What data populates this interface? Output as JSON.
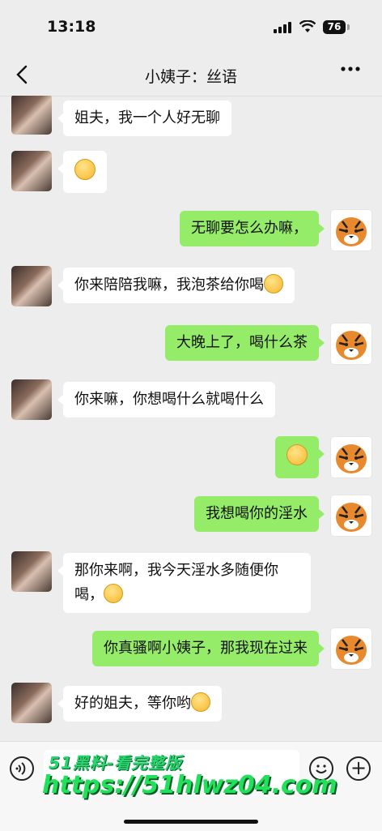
{
  "status_bar": {
    "time": "13:18",
    "battery": "76"
  },
  "nav": {
    "back_icon": "chevron-left-icon",
    "title": "小姨子：丝语",
    "more_icon": "more-dots-icon"
  },
  "messages": [
    {
      "side": "in",
      "text": "姐夫，我一个人好无聊"
    },
    {
      "side": "in",
      "text": "",
      "emoji": "pleading-face"
    },
    {
      "side": "out",
      "text": "无聊要怎么办嘛，"
    },
    {
      "side": "in",
      "text": "你来陪陪我嘛，我泡茶给你喝",
      "emoji": "grinning-face"
    },
    {
      "side": "out",
      "text": "大晚上了，喝什么茶"
    },
    {
      "side": "in",
      "text": "你来嘛，你想喝什么就喝什么"
    },
    {
      "side": "out",
      "text": "",
      "emoji": "grinning-face"
    },
    {
      "side": "out",
      "text": "我想喝你的淫水"
    },
    {
      "side": "in",
      "text": "那你来啊，我今天淫水多随便你",
      "text2": "喝，",
      "emoji": "thinking-face"
    },
    {
      "side": "out",
      "text": "你真骚啊小姨子，那我现在过来"
    },
    {
      "side": "in",
      "text": "好的姐夫，等你哟",
      "emoji": "smirking-face"
    }
  ],
  "watermark": {
    "line1": "51黑料-看完整版",
    "line2": "https://51hlwz04.com"
  },
  "input_bar": {
    "voice_icon": "voice-icon",
    "emoji_icon": "smile-icon",
    "plus_icon": "plus-icon"
  }
}
